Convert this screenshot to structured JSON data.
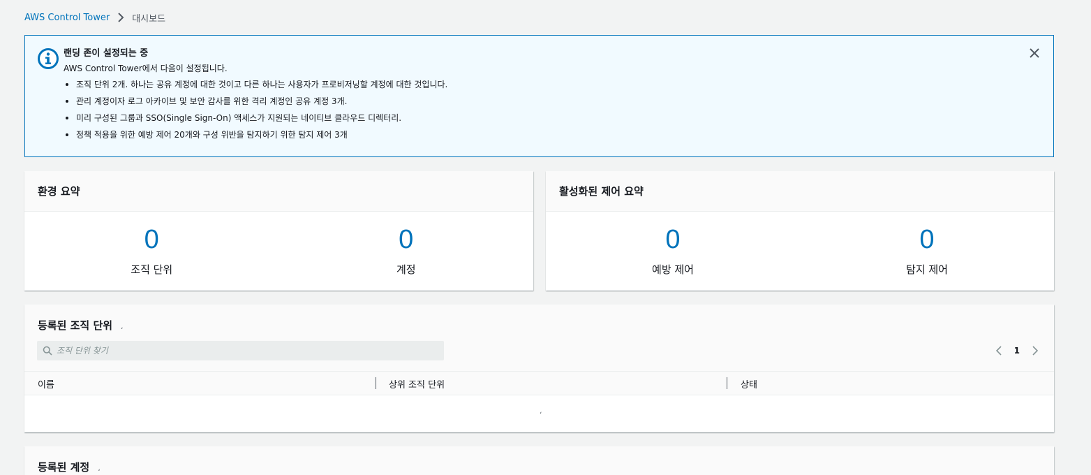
{
  "breadcrumb": {
    "root": "AWS Control Tower",
    "current": "대시보드"
  },
  "flash": {
    "title": "랜딩 존이 설정되는 중",
    "intro": "AWS Control Tower에서 다음이 설정됩니다.",
    "items": [
      "조직 단위 2개. 하나는 공유 계정에 대한 것이고 다른 하나는 사용자가 프로비저닝할 계정에 대한 것입니다.",
      "관리 계정이자 로그 아카이브 및 보안 감사를 위한 격리 계정인 공유 계정 3개.",
      "미리 구성된 그룹과 SSO(Single Sign-On) 액세스가 지원되는 네이티브 클라우드 디렉터리.",
      "정책 적용을 위한 예방 제어 20개와 구성 위반을 탐지하기 위한 탐지 제어 3개"
    ],
    "icon": "info-icon",
    "close_icon": "close-icon"
  },
  "environment_summary": {
    "title": "환경 요약",
    "stats": [
      {
        "value": "0",
        "label": "조직 단위"
      },
      {
        "value": "0",
        "label": "계정"
      }
    ]
  },
  "controls_summary": {
    "title": "활성화된 제어 요약",
    "stats": [
      {
        "value": "0",
        "label": "예방 제어"
      },
      {
        "value": "0",
        "label": "탐지 제어"
      }
    ]
  },
  "ou_table": {
    "title": "등록된 조직 단위",
    "title_mark": "،",
    "search_placeholder": "조직 단위 찾기",
    "page": "1",
    "columns": [
      "이름",
      "상위 조직 단위",
      "상태"
    ],
    "empty_mark": "،"
  },
  "accounts_table": {
    "title": "등록된 계정",
    "title_mark": "،"
  },
  "colors": {
    "accent": "#0073bb",
    "background": "#f2f3f3",
    "flash_bg": "#f1faff"
  }
}
